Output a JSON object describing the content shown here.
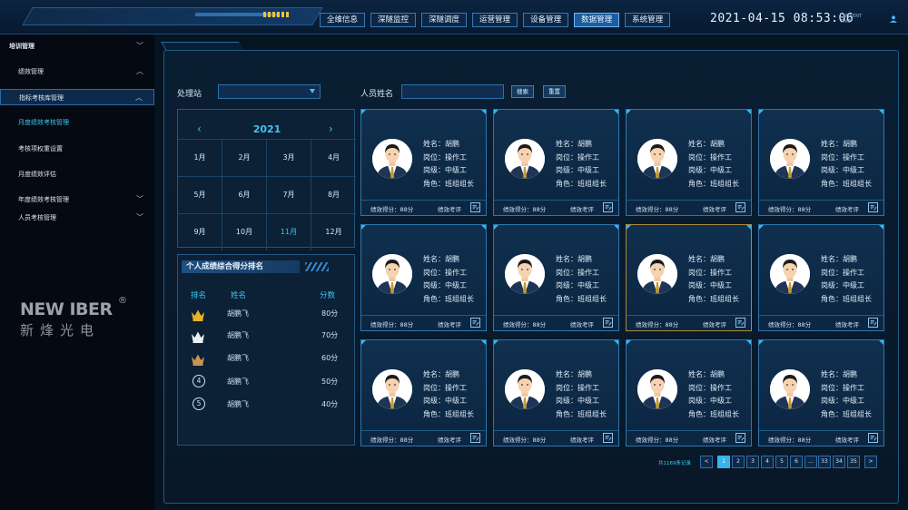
{
  "nav": {
    "items": [
      "全维信息",
      "深隧监控",
      "深隧调度",
      "运营管理",
      "设备管理",
      "数据管理",
      "系统管理"
    ],
    "active_index": 5
  },
  "clock": {
    "time": "2021-04-15 08:53:06",
    "sub1": "CURRENT",
    "sub2": "TIME"
  },
  "sidebar": {
    "items": [
      {
        "label": "培训管理",
        "chevron": "down"
      },
      {
        "label": "绩效管理",
        "chevron": "up"
      },
      {
        "label": "指标考核库管理",
        "chevron": "up"
      },
      {
        "label": "月度绩效考核管理",
        "chevron": ""
      },
      {
        "label": "考核项权重设置",
        "chevron": ""
      },
      {
        "label": "月度绩效评估",
        "chevron": ""
      },
      {
        "label": "年度绩效考核管理",
        "chevron": "down"
      },
      {
        "label": "人员考核管理",
        "chevron": "down"
      }
    ]
  },
  "logo": {
    "main": "NEW IBER",
    "reg": "®",
    "cn": "新烽光电"
  },
  "filters": {
    "station_label": "处理站",
    "name_label": "人员姓名",
    "name_value": "",
    "search_label": "搜索",
    "reset_label": "重置"
  },
  "calendar": {
    "year": "2021",
    "prev": "‹",
    "next": "›",
    "months": [
      "1月",
      "2月",
      "3月",
      "4月",
      "5月",
      "6月",
      "7月",
      "8月",
      "9月",
      "10月",
      "11月",
      "12月"
    ],
    "selected_index": 10
  },
  "ranking": {
    "title": "个人成绩综合得分排名",
    "headers": {
      "rank": "排名",
      "name": "姓名",
      "score": "分数"
    },
    "rows": [
      {
        "rank": "1",
        "name": "胡鹏飞",
        "score": "80分",
        "crown": "gold"
      },
      {
        "rank": "2",
        "name": "胡鹏飞",
        "score": "70分",
        "crown": "silver"
      },
      {
        "rank": "3",
        "name": "胡鹏飞",
        "score": "60分",
        "crown": "bronze"
      },
      {
        "rank": "4",
        "name": "胡鹏飞",
        "score": "50分",
        "crown": ""
      },
      {
        "rank": "5",
        "name": "胡鹏飞",
        "score": "40分",
        "crown": ""
      }
    ],
    "colors": {
      "gold": "#e6b426",
      "silver": "#e8eef4",
      "bronze": "#c7954f"
    }
  },
  "cards": [
    {
      "name": "姓名：胡鹏",
      "post": "岗位：操作工",
      "level": "岗级：中级工",
      "role": "角色：班组组长",
      "score": "绩效得分：88分",
      "eval": "绩效考评"
    },
    {
      "name": "姓名：胡鹏",
      "post": "岗位：操作工",
      "level": "岗级：中级工",
      "role": "角色：班组组长",
      "score": "绩效得分：88分",
      "eval": "绩效考评"
    },
    {
      "name": "姓名：胡鹏",
      "post": "岗位：操作工",
      "level": "岗级：中级工",
      "role": "角色：班组组长",
      "score": "绩效得分：88分",
      "eval": "绩效考评"
    },
    {
      "name": "姓名：胡鹏",
      "post": "岗位：操作工",
      "level": "岗级：中级工",
      "role": "角色：班组组长",
      "score": "绩效得分：88分",
      "eval": "绩效考评"
    },
    {
      "name": "姓名：胡鹏",
      "post": "岗位：操作工",
      "level": "岗级：中级工",
      "role": "角色：班组组长",
      "score": "绩效得分：88分",
      "eval": "绩效考评"
    },
    {
      "name": "姓名：胡鹏",
      "post": "岗位：操作工",
      "level": "岗级：中级工",
      "role": "角色：班组组长",
      "score": "绩效得分：88分",
      "eval": "绩效考评"
    },
    {
      "name": "姓名：胡鹏",
      "post": "岗位：操作工",
      "level": "岗级：中级工",
      "role": "角色：班组组长",
      "score": "绩效得分：88分",
      "eval": "绩效考评"
    },
    {
      "name": "姓名：胡鹏",
      "post": "岗位：操作工",
      "level": "岗级：中级工",
      "role": "角色：班组组长",
      "score": "绩效得分：88分",
      "eval": "绩效考评"
    },
    {
      "name": "姓名：胡鹏",
      "post": "岗位：操作工",
      "level": "岗级：中级工",
      "role": "角色：班组组长",
      "score": "绩效得分：88分",
      "eval": "绩效考评"
    },
    {
      "name": "姓名：胡鹏",
      "post": "岗位：操作工",
      "level": "岗级：中级工",
      "role": "角色：班组组长",
      "score": "绩效得分：88分",
      "eval": "绩效考评"
    },
    {
      "name": "姓名：胡鹏",
      "post": "岗位：操作工",
      "level": "岗级：中级工",
      "role": "角色：班组组长",
      "score": "绩效得分：88分",
      "eval": "绩效考评"
    },
    {
      "name": "姓名：胡鹏",
      "post": "岗位：操作工",
      "level": "岗级：中级工",
      "role": "角色：班组组长",
      "score": "绩效得分：88分",
      "eval": "绩效考评"
    }
  ],
  "highlighted_card": 6,
  "pagination": {
    "total": "共1169条记录",
    "pages": [
      "<",
      "1",
      "2",
      "3",
      "4",
      "5",
      "6",
      "...",
      "33",
      "34",
      "35",
      ">"
    ],
    "active": "1"
  }
}
